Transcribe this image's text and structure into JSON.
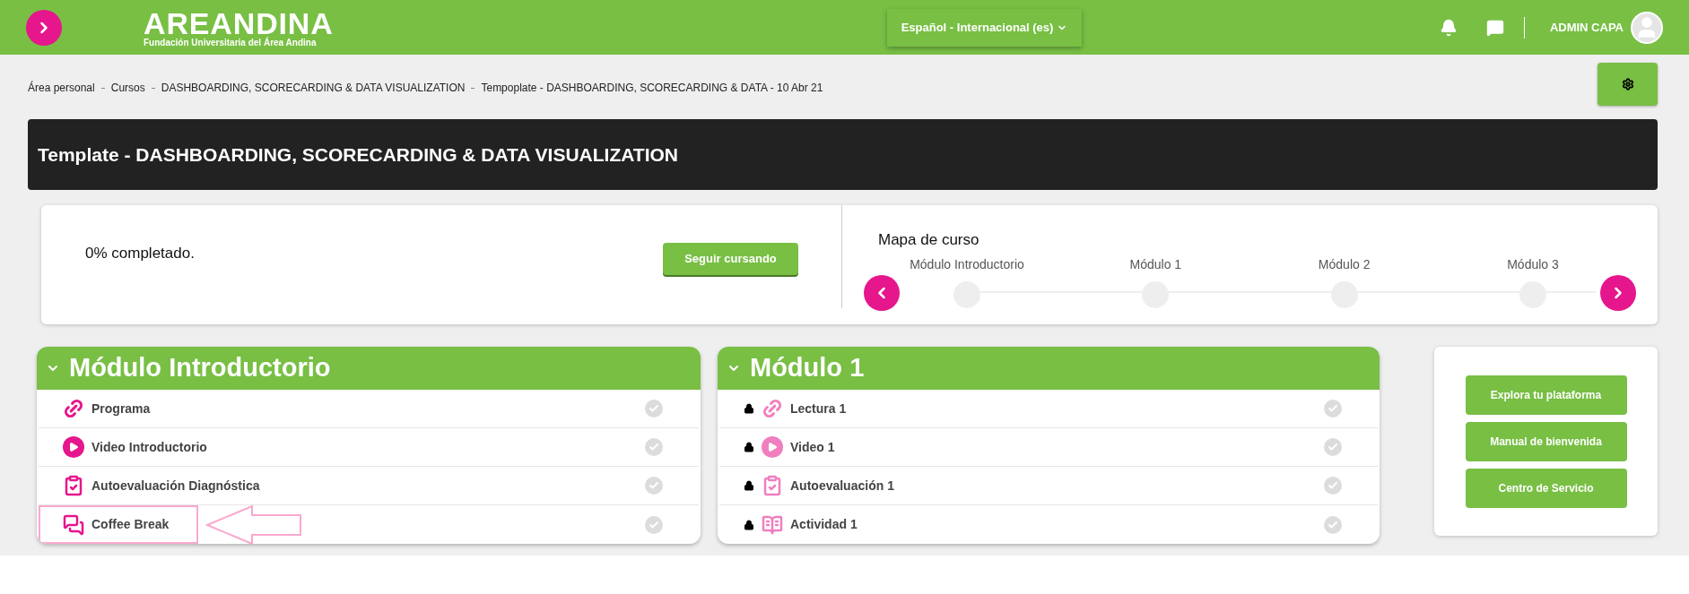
{
  "header": {
    "logo_title": "AREANDINA",
    "logo_subtitle": "Fundación Universitaria del Área Andina",
    "language": "Español - Internacional (es)",
    "user_name": "ADMIN CAPA"
  },
  "breadcrumb": [
    "Área personal",
    "Cursos",
    "DASHBOARDING, SCORECARDING & DATA VISUALIZATION",
    "Tempoplate - DASHBOARDING, SCORECARDING & DATA - 10 Abr 21"
  ],
  "course_title": "Template - DASHBOARDING, SCORECARDING & DATA VISUALIZATION",
  "progress": {
    "text": "0% completado.",
    "button": "Seguir cursando"
  },
  "course_map": {
    "title": "Mapa de curso",
    "steps": [
      {
        "label": "Módulo Introductorio",
        "completed": false
      },
      {
        "label": "Módulo 1",
        "completed": false
      },
      {
        "label": "Módulo 2",
        "completed": false
      },
      {
        "label": "Módulo 3",
        "completed": false
      }
    ]
  },
  "modules": [
    {
      "title": "Módulo Introductorio",
      "expanded": true,
      "items": [
        {
          "label": "Programa",
          "kind": "link",
          "locked": false,
          "completed": false,
          "highlighted": false
        },
        {
          "label": "Video Introductorio",
          "kind": "video",
          "locked": false,
          "completed": false,
          "highlighted": false
        },
        {
          "label": "Autoevaluación Diagnóstica",
          "kind": "quiz",
          "locked": false,
          "completed": false,
          "highlighted": false
        },
        {
          "label": "Coffee Break",
          "kind": "forum",
          "locked": false,
          "completed": false,
          "highlighted": true
        }
      ]
    },
    {
      "title": "Módulo 1",
      "expanded": true,
      "items": [
        {
          "label": "Lectura 1",
          "kind": "link",
          "locked": true,
          "completed": false,
          "highlighted": false
        },
        {
          "label": "Video 1",
          "kind": "video",
          "locked": true,
          "completed": false,
          "highlighted": false
        },
        {
          "label": "Autoevaluación 1",
          "kind": "quiz",
          "locked": true,
          "completed": false,
          "highlighted": false
        },
        {
          "label": "Actividad 1",
          "kind": "assignment",
          "locked": true,
          "completed": false,
          "highlighted": false
        }
      ]
    }
  ],
  "side_buttons": [
    "Explora tu plataforma",
    "Manual de bienvenida",
    "Centro de Servicio"
  ]
}
